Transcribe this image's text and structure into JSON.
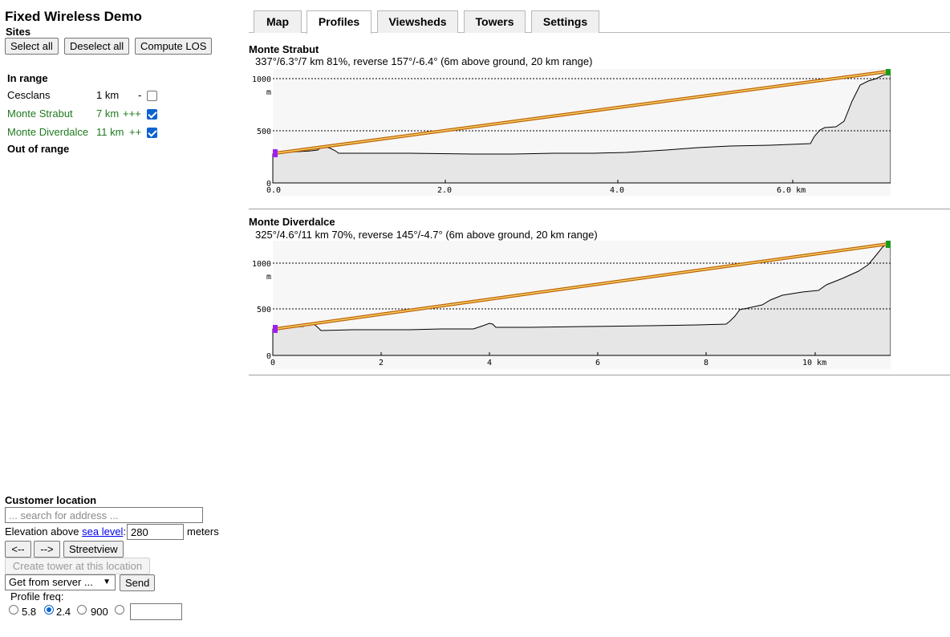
{
  "app": {
    "title": "Fixed Wireless Demo"
  },
  "sites": {
    "title": "Sites",
    "buttons": {
      "select_all": "Select all",
      "deselect_all": "Deselect all",
      "compute_los": "Compute LOS"
    },
    "in_range_title": "In range",
    "out_of_range_title": "Out of range",
    "items": [
      {
        "name": "Cesclans",
        "distance": "1 km",
        "quality": "-",
        "checked": false
      },
      {
        "name": "Monte Strabut",
        "distance": "7 km",
        "quality": "+++",
        "checked": true
      },
      {
        "name": "Monte Diverdalce",
        "distance": "11 km",
        "quality": "++",
        "checked": true
      }
    ]
  },
  "tabs": [
    {
      "label": "Map",
      "active": false
    },
    {
      "label": "Profiles",
      "active": true
    },
    {
      "label": "Viewsheds",
      "active": false
    },
    {
      "label": "Towers",
      "active": false
    },
    {
      "label": "Settings",
      "active": false
    }
  ],
  "profiles": [
    {
      "name": "Monte Strabut",
      "summary": "337°/6.3°/7 km 81%, reverse 157°/-6.4° (6m above ground, 20 km range)",
      "y_ticks": [
        "1000",
        "500",
        "0"
      ],
      "y_unit": "m",
      "x_ticks": [
        "0.0",
        "2.0",
        "4.0",
        "6.0 km"
      ]
    },
    {
      "name": "Monte Diverdalce",
      "summary": "325°/4.6°/11 km 70%, reverse 145°/-4.7° (6m above ground, 20 km range)",
      "y_ticks": [
        "1000",
        "500",
        "0"
      ],
      "y_unit": "m",
      "x_ticks": [
        "0",
        "2",
        "4",
        "6",
        "8",
        "10 km"
      ]
    }
  ],
  "customer": {
    "title": "Customer location",
    "search_placeholder": "... search for address ...",
    "elevation_label": "Elevation above ",
    "sea_level_link": "sea level",
    "elevation_colon": ":",
    "elevation_value": "280",
    "elevation_unit": "meters",
    "prev_button": "<--",
    "next_button": "-->",
    "streetview_button": "Streetview",
    "create_tower_button": "Create tower at this location",
    "server_select": "Get from server ...",
    "send_button": "Send",
    "profile_freq_label": "Profile freq:",
    "freq_options": [
      {
        "label": "5.8",
        "selected": false
      },
      {
        "label": "2.4",
        "selected": true
      },
      {
        "label": "900",
        "selected": false
      }
    ]
  },
  "colors": {
    "site_in_range": "#1f7a1f",
    "los_line": "#d4a000",
    "los_outline": "#c06000",
    "start_marker": "#a020f0",
    "end_marker": "#1a9a1a",
    "terrain_fill": "#e6e6e6",
    "plot_bg": "#f7f7f7"
  }
}
